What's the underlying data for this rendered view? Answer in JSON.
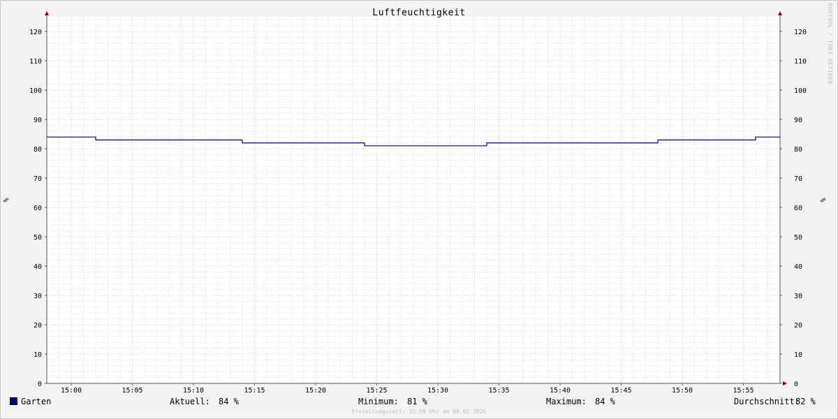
{
  "chart_data": {
    "type": "line",
    "title": "Luftfeuchtigkeit",
    "ylabel_left": "%",
    "ylabel_right": "%",
    "x_unit": "minutes",
    "x_ticks": [
      "15:00",
      "15:05",
      "15:10",
      "15:15",
      "15:20",
      "15:25",
      "15:30",
      "15:35",
      "15:40",
      "15:45",
      "15:50",
      "15:55"
    ],
    "x_tick_values": [
      0,
      5,
      10,
      15,
      20,
      25,
      30,
      35,
      40,
      45,
      50,
      55
    ],
    "xlim": [
      -2,
      58
    ],
    "ylim": [
      0,
      125
    ],
    "y_ticks": [
      0,
      10,
      20,
      30,
      40,
      50,
      60,
      70,
      80,
      90,
      100,
      110,
      120
    ],
    "grid": true,
    "series": [
      {
        "name": "Garten",
        "color": "#00008b",
        "points": [
          [
            -2,
            84
          ],
          [
            2,
            84
          ],
          [
            2,
            83
          ],
          [
            14,
            83
          ],
          [
            14,
            82
          ],
          [
            24,
            82
          ],
          [
            24,
            81
          ],
          [
            34,
            81
          ],
          [
            34,
            82
          ],
          [
            48,
            82
          ],
          [
            48,
            83
          ],
          [
            56,
            83
          ],
          [
            56,
            84
          ],
          [
            58,
            84
          ]
        ]
      }
    ]
  },
  "legend": {
    "series_name": "Garten",
    "current_label": "Aktuell:",
    "current_value": "84 %",
    "min_label": "Minimum:",
    "min_value": "81 %",
    "max_label": "Maximum:",
    "max_value": "84 %",
    "avg_label": "Durchschnitt:",
    "avg_value": "82 %"
  },
  "footer": "Erstellungszeit: 15:58 Uhr am 08.02.2026",
  "watermark": "RRDTOOL / TOBI OETIKER",
  "colors": {
    "background": "#f3f3f3",
    "plot_background": "#ffffff",
    "major_grid": "#ffb0b0",
    "minor_grid": "#c8c8c8",
    "axis": "#555555",
    "arrow": "#a00000",
    "line": "#00008b"
  }
}
